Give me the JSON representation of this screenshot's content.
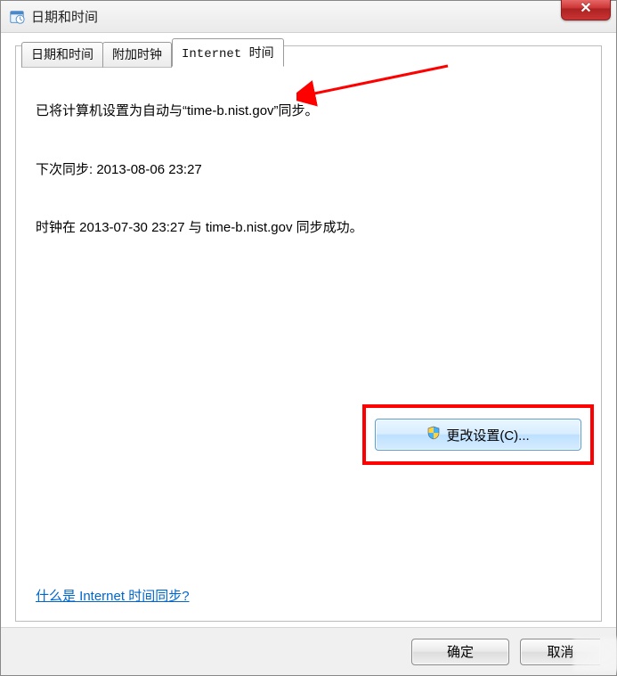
{
  "window": {
    "title": "日期和时间"
  },
  "tabs": {
    "items": [
      {
        "label": "日期和时间",
        "active": false
      },
      {
        "label": "附加时钟",
        "active": false
      },
      {
        "label": "Internet 时间",
        "active": true
      }
    ]
  },
  "panel": {
    "sync_status_line": "已将计算机设置为自动与“time-b.nist.gov”同步。",
    "next_sync_line": "下次同步: 2013-08-06 23:27",
    "last_sync_line": "时钟在 2013-07-30 23:27 与 time-b.nist.gov 同步成功。",
    "change_settings_label": "更改设置(C)...",
    "help_link_label": "什么是 Internet 时间同步?"
  },
  "footer": {
    "ok_label": "确定",
    "cancel_label": "取消"
  },
  "icons": {
    "close_x": "✕"
  },
  "colors": {
    "highlight_box": "#ff0000",
    "link": "#0066cc",
    "close_bg": "#c33"
  }
}
